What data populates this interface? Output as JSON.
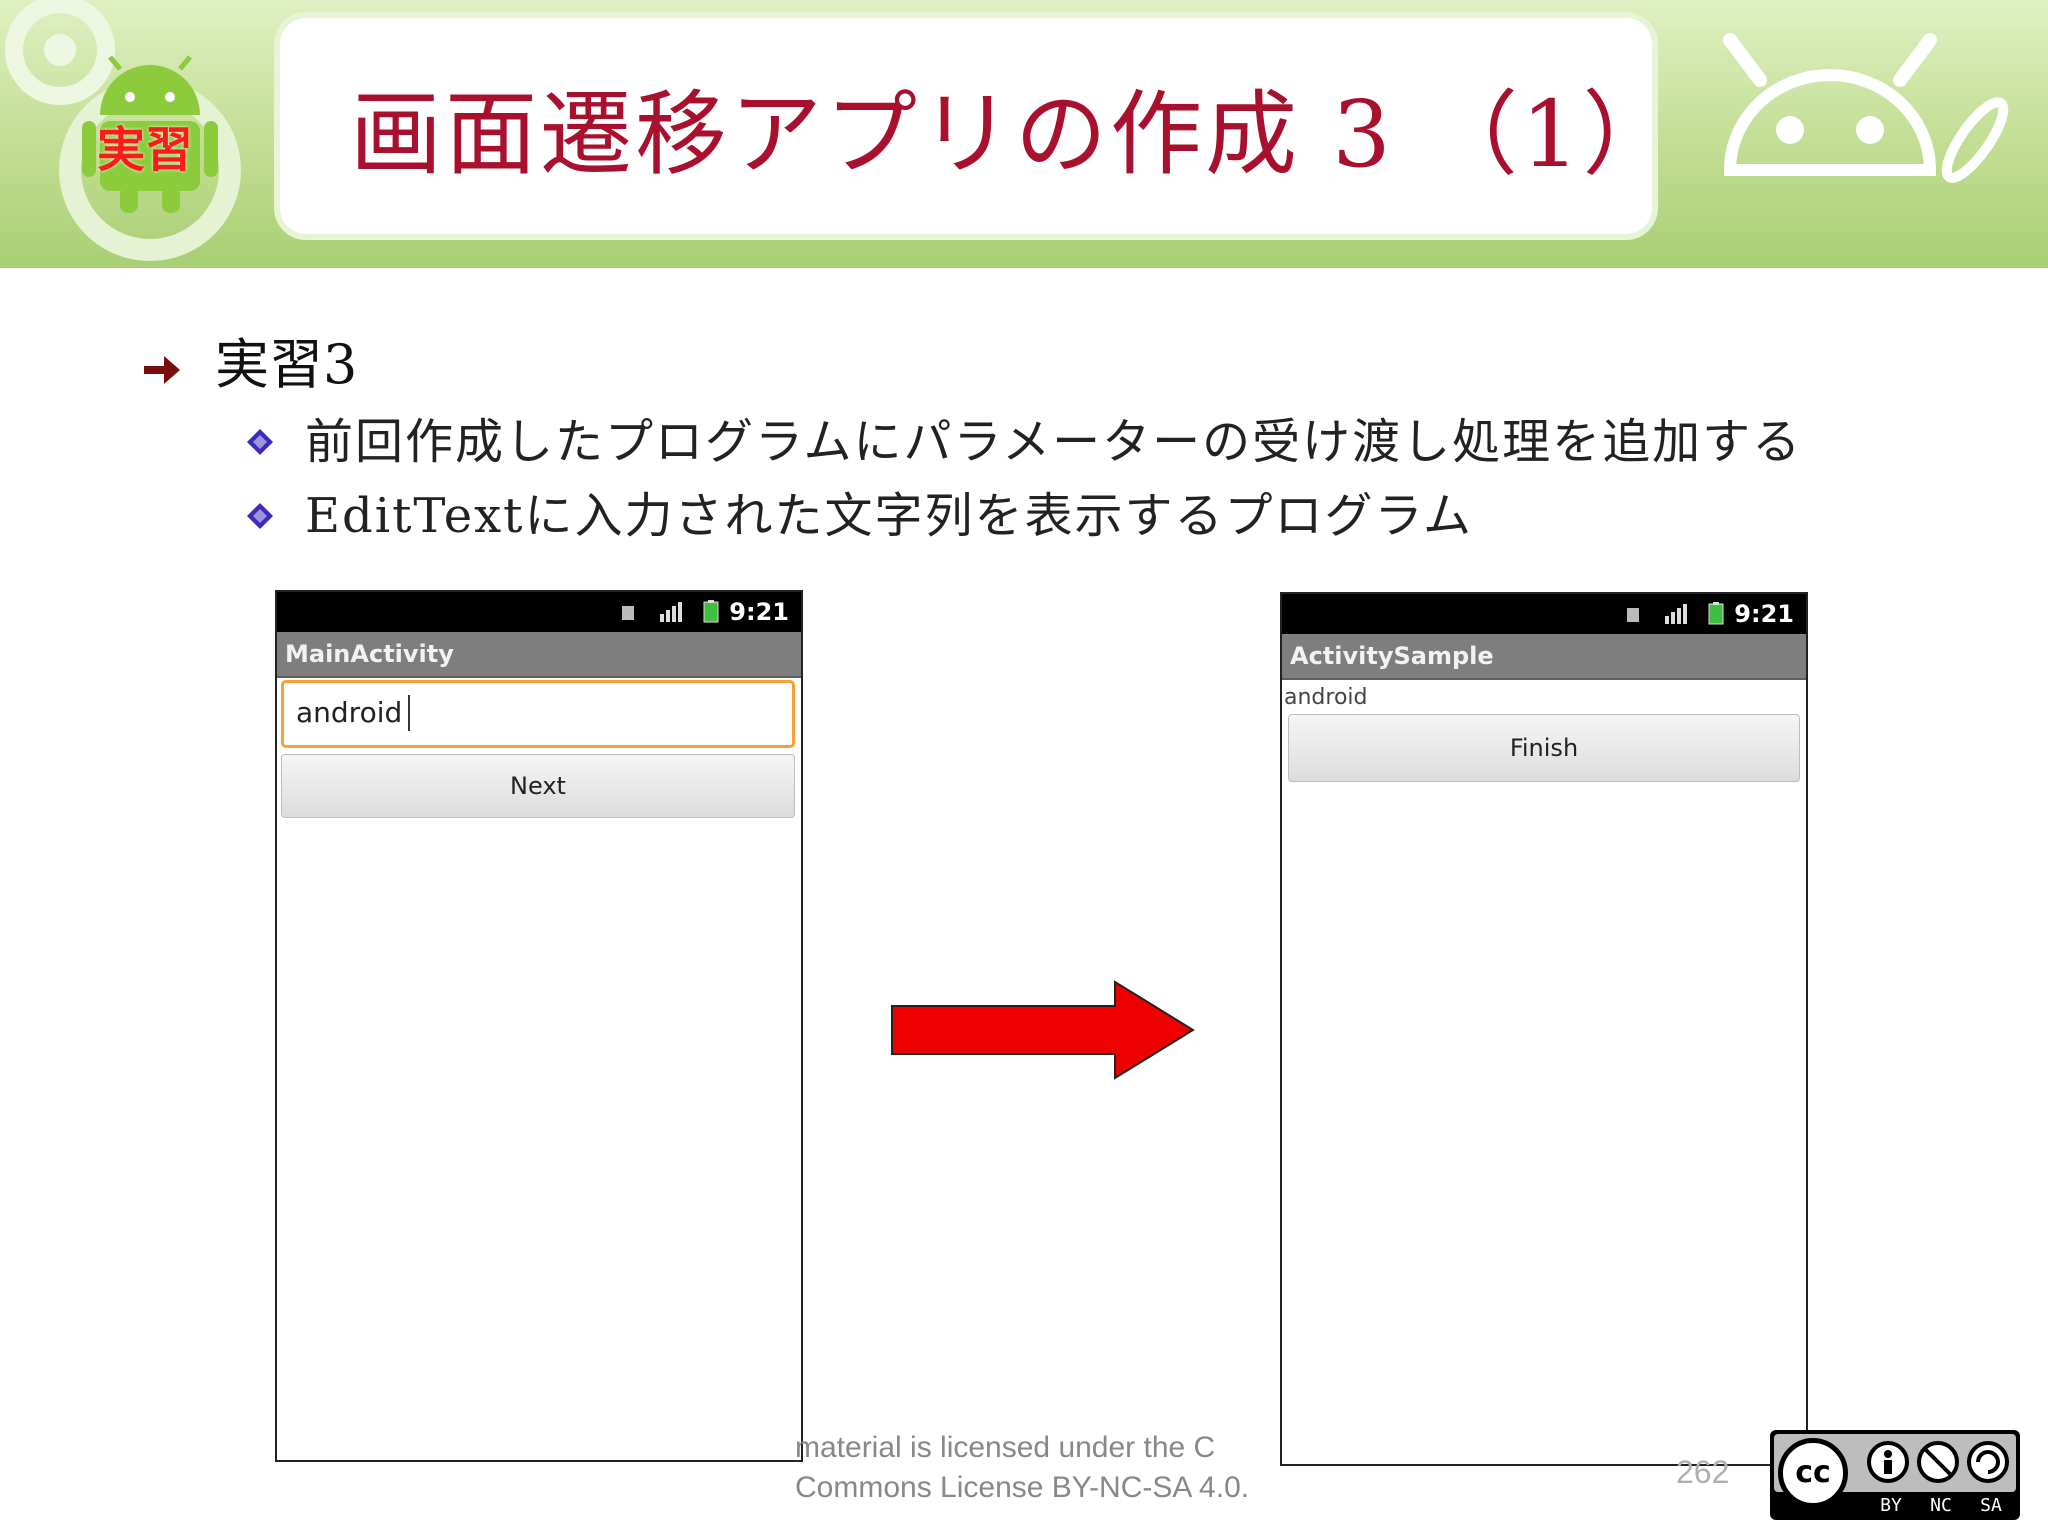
{
  "slide": {
    "title": "画面遷移アプリの作成 3 （1）",
    "badge": "実習",
    "bullet_main": "実習3",
    "bullets_sub": [
      "前回作成したプログラムにパラメーターの受け渡し処理を追加する",
      "EditTextに入力された文字列を表示するプログラム"
    ]
  },
  "phone_left": {
    "time": "9:21",
    "app_title": "MainActivity",
    "input_value": "android",
    "button_label": "Next"
  },
  "phone_right": {
    "time": "9:21",
    "app_title": "ActivitySample",
    "text_value": "android",
    "button_label": "Finish"
  },
  "footer": {
    "license_line1": "material is licensed under the C",
    "license_line2": "Commons License BY-NC-SA 4.0.",
    "page_number": "262",
    "cc_labels": {
      "cc": "cc",
      "by": "BY",
      "nc": "NC",
      "sa": "SA"
    }
  },
  "colors": {
    "title": "#a8102d",
    "header_green": "#bfdc8f",
    "arrow_red": "#ee0000",
    "bullet_diamond": "#3b2bbd",
    "edit_focus": "#f7a035"
  },
  "icons": [
    "android-robot-icon",
    "gear-icon",
    "bullet-arrow-icon",
    "diamond-bullet-icon",
    "signal-icon",
    "battery-icon",
    "right-arrow-icon",
    "cc-license-icon"
  ]
}
